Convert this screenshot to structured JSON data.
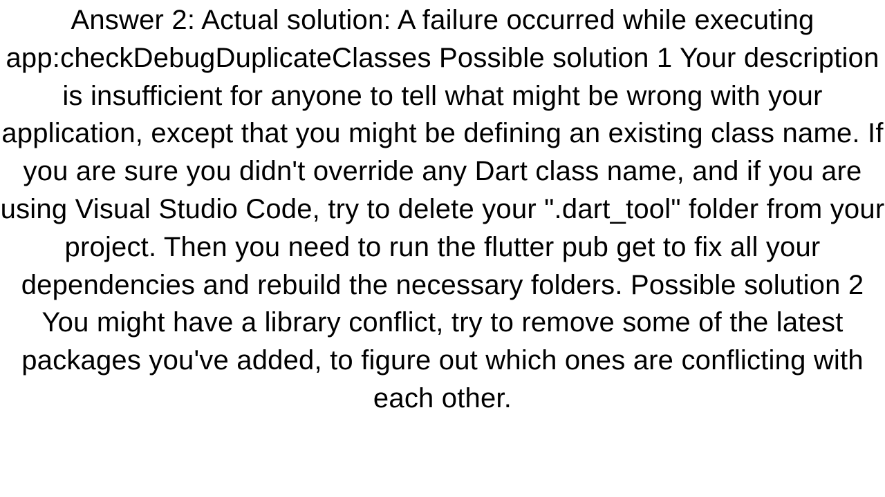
{
  "answer": {
    "text": "Answer 2: Actual solution: A failure occurred while executing app:checkDebugDuplicateClasses Possible solution 1 Your description is insufficient for anyone to tell what might be wrong with your application, except that you might be defining an existing class name. If you are sure you didn't override any Dart class name, and if you are using Visual Studio Code, try to delete your \".dart_tool\" folder from your project. Then you need to run the flutter pub get to fix all your dependencies and rebuild the necessary folders. Possible solution 2 You might have a library conflict, try to remove some of the latest packages you've added, to figure out which ones are conflicting with each other."
  }
}
